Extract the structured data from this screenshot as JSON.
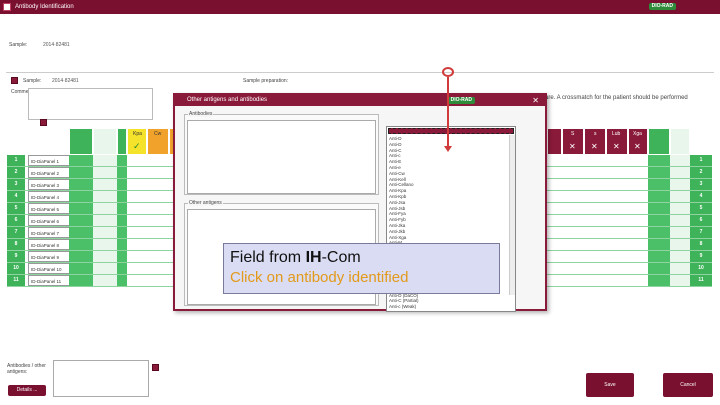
{
  "window": {
    "title": "Antibody Identification",
    "logo": "DIO-RAD"
  },
  "header": {
    "sample_label": "Sample:",
    "sample_value": "2014·82481"
  },
  "sample_panel": {
    "sample_label": "Sample:",
    "sample_value": "2014·82481",
    "comment_label": "Comment:",
    "preparation_label": "Sample preparation:",
    "crossmatch_text": "are. A crossmatch for the patient should be performed"
  },
  "table": {
    "col_headers": [
      "Kpa",
      "Cw",
      "S",
      "s",
      "Lub",
      "Xga"
    ],
    "rows": [
      {
        "num": "1",
        "panel": "ID-DiaPanel 1",
        "rnum": "1"
      },
      {
        "num": "2",
        "panel": "ID-DiaPanel 2",
        "rnum": "2"
      },
      {
        "num": "3",
        "panel": "ID-DiaPanel 3",
        "rnum": "3"
      },
      {
        "num": "4",
        "panel": "ID-DiaPanel 4",
        "rnum": "4"
      },
      {
        "num": "5",
        "panel": "ID-DiaPanel 5",
        "rnum": "5"
      },
      {
        "num": "6",
        "panel": "ID-DiaPanel 6",
        "rnum": "6"
      },
      {
        "num": "7",
        "panel": "ID-DiaPanel 7",
        "rnum": "7"
      },
      {
        "num": "8",
        "panel": "ID-DiaPanel 8",
        "rnum": "8"
      },
      {
        "num": "9",
        "panel": "ID-DiaPanel 9",
        "rnum": "9"
      },
      {
        "num": "10",
        "panel": "ID-DiaPanel 10",
        "rnum": "10"
      },
      {
        "num": "11",
        "panel": "ID-DiaPanel 11",
        "rnum": "11"
      }
    ]
  },
  "dialog": {
    "title": "Other antigens and antibodies",
    "logo": "DIO-RAD",
    "close": "✕",
    "antibodies_label": "Antibodies",
    "other_antigens_label": "Other antigens",
    "list_items": [
      "Anti-D",
      "Anti-D",
      "Anti-C",
      "Anti-c",
      "Anti-E",
      "Anti-e",
      "Anti-Cw",
      "Anti-Kell",
      "Anti-Cellano",
      "Anti-Kpa",
      "Anti-Kpb",
      "Anti-Jsa",
      "Anti-Jsb",
      "Anti-Fya",
      "Anti-Fyb",
      "Anti-Jka",
      "Anti-Jkb",
      "Anti-Xga",
      "Anti-M",
      "Anti-N",
      "Anti-S",
      "Anti-s",
      "Anti-P1",
      "Anti-Lea",
      "Anti-Leb",
      "Anti-Lua",
      "Anti-Lub",
      "Anti-D (DaCO)",
      "Anti-C (Partial)",
      "Anti-c (Weak)"
    ]
  },
  "tooltip": {
    "line1_pre": "Field from ",
    "line1_bold": "IH",
    "line1_post": "-Com",
    "line2": "Click on antibody identified"
  },
  "bottom": {
    "abs_label": "Antibodies / other antigens:",
    "details_button": "Details ...",
    "save_button": "Save",
    "cancel_button": "Cancel"
  },
  "colors": {
    "brand": "#7a1030",
    "grid_green": "#3fb35a",
    "annotation": "#d03a3a",
    "tooltip_bg": "#d9dcf2"
  }
}
